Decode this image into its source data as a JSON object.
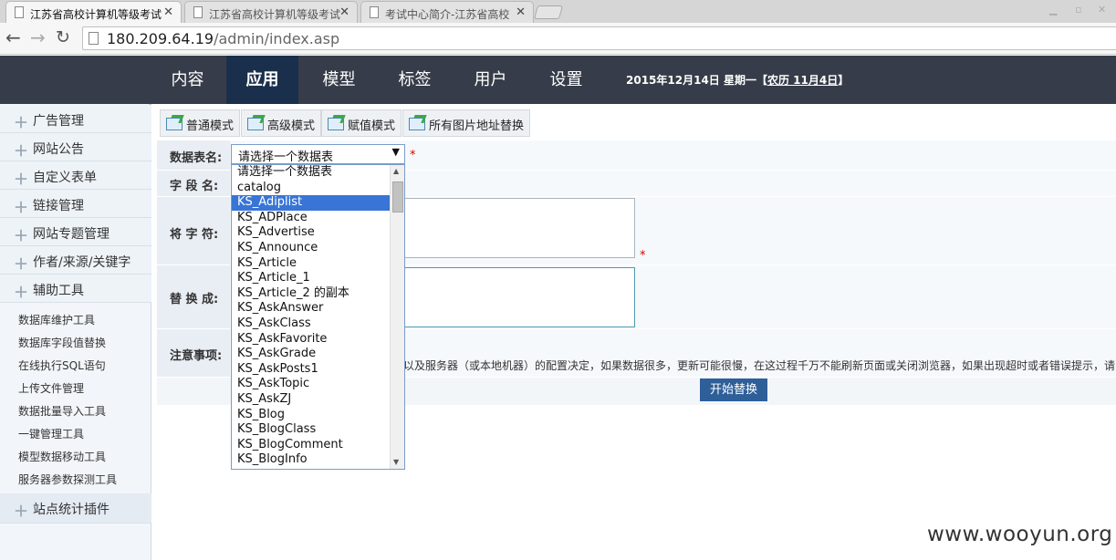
{
  "browser": {
    "tabs": [
      {
        "title": "江苏省高校计算机等级考试",
        "active": true
      },
      {
        "title": "江苏省高校计算机等级考试"
      },
      {
        "title": "考试中心简介-江苏省高校"
      }
    ],
    "url_host": "180.209.64.19",
    "url_path": "/admin/index.asp"
  },
  "topnav": {
    "items": [
      "内容",
      "应用",
      "模型",
      "标签",
      "用户",
      "设置"
    ],
    "active": "应用",
    "date_prefix": "2015年12月14日 星期一【",
    "date_lunar": "农历 11月4日",
    "date_suffix": "】"
  },
  "sidebar": {
    "sections": [
      "广告管理",
      "网站公告",
      "自定义表单",
      "链接管理",
      "网站专题管理",
      "作者/来源/关键字",
      "辅助工具"
    ],
    "tools": [
      "数据库维护工具",
      "数据库字段值替换",
      "在线执行SQL语句",
      "上传文件管理",
      "数据批量导入工具",
      "一键管理工具",
      "模型数据移动工具",
      "服务器参数探测工具"
    ],
    "footer_section": "站点统计插件"
  },
  "toolbar": {
    "buttons": [
      "普通模式",
      "高级模式",
      "赋值模式",
      "所有图片地址替换"
    ]
  },
  "form": {
    "table_label": "数据表名:",
    "field_label": "字 段 名:",
    "find_label": "将 字 符:",
    "replace_label": "替 换 成:",
    "note_label": "注意事项:",
    "required_mark": "*",
    "select_value": "请选择一个数据表",
    "note_text": "少以及服务器（或本地机器）的配置决定，如果数据很多，更新可能很慢，在这过程千万不能刷新页面或关闭浏览器，如果出现超时或者错误提示，请",
    "submit_label": "开始替换"
  },
  "dropdown": {
    "options": [
      "请选择一个数据表",
      "catalog",
      "KS_Adiplist",
      "KS_ADPlace",
      "KS_Advertise",
      "KS_Announce",
      "KS_Article",
      "KS_Article_1",
      "KS_Article_2 的副本",
      "KS_AskAnswer",
      "KS_AskClass",
      "KS_AskFavorite",
      "KS_AskGrade",
      "KS_AskPosts1",
      "KS_AskTopic",
      "KS_AskZJ",
      "KS_Blog",
      "KS_BlogClass",
      "KS_BlogComment",
      "KS_BlogInfo"
    ],
    "highlighted": "KS_Adiplist"
  },
  "watermark": "www.wooyun.org",
  "colors": {
    "nav_bg": "#363c49",
    "nav_active": "#1a2f4b",
    "selection": "#3875d7",
    "button": "#2f5f99"
  }
}
